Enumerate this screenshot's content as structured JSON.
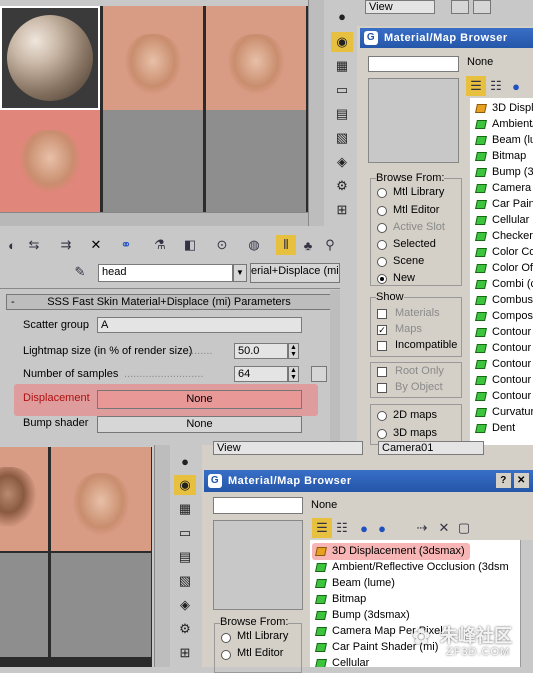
{
  "top": {
    "view_dropdown": "View",
    "name_field": "head",
    "mat_type_button": "erial+Displace (mi)",
    "rollout_title": "SSS Fast Skin Material+Displace (mi) Parameters",
    "params": [
      {
        "label": "Scatter group",
        "value": "A"
      },
      {
        "label": "Lightmap size (in % of render size)",
        "value": "50.0"
      },
      {
        "label": "Number of samples",
        "value": "64"
      },
      {
        "label": "Displacement",
        "value": "None"
      },
      {
        "label": "Bump shader",
        "value": "None"
      }
    ]
  },
  "browser1": {
    "title": "Material/Map Browser",
    "none_label": "None",
    "items": [
      "3D Displ",
      "Ambient/",
      "Beam (lu",
      "Bitmap",
      "Bump (3d",
      "Camera I",
      "Car Pain",
      "Cellular",
      "Checker",
      "Color Co",
      "Color Of",
      "Combi (c",
      "Combust",
      "Composi",
      "Contour",
      "Contour",
      "Contour",
      "Contour",
      "Contour",
      "Curvatur",
      "Dent"
    ],
    "browse_from_title": "Browse From:",
    "browse_from": [
      {
        "label": "Mtl Library",
        "on": false,
        "dim": false
      },
      {
        "label": "Mtl Editor",
        "on": false,
        "dim": false
      },
      {
        "label": "Active Slot",
        "on": false,
        "dim": true
      },
      {
        "label": "Selected",
        "on": false,
        "dim": false
      },
      {
        "label": "Scene",
        "on": false,
        "dim": false
      },
      {
        "label": "New",
        "on": true,
        "dim": false
      }
    ],
    "show_title": "Show",
    "show": [
      {
        "label": "Materials",
        "checked": false,
        "dim": true
      },
      {
        "label": "Maps",
        "checked": true,
        "dim": true
      },
      {
        "label": "Incompatible",
        "checked": false,
        "dim": false
      }
    ],
    "extra": [
      {
        "label": "Root Only",
        "dim": true
      },
      {
        "label": "By Object",
        "dim": true
      }
    ],
    "maps": [
      "2D maps",
      "3D maps"
    ]
  },
  "bottom": {
    "view_dropdown": "View",
    "camera_dropdown": "Camera01",
    "browser_title": "Material/Map Browser",
    "none_label": "None",
    "items": [
      "3D Displacement (3dsmax)",
      "Ambient/Reflective Occlusion (3dsm",
      "Beam (lume)",
      "Bitmap",
      "Bump (3dsmax)",
      "Camera Map Per Pixel",
      "Car Paint Shader (mi)",
      "Cellular"
    ],
    "browse_from_title": "Browse From:",
    "browse_from": [
      "Mtl Library",
      "Mtl Editor"
    ]
  },
  "watermark": {
    "line1": "朱峰社区",
    "line2": "ZF3D.COM"
  },
  "colors": {
    "skin": "#d89b84",
    "highlight": "#f07878",
    "titlebar": "#2456a8",
    "map_icon": "#3cc43c"
  }
}
